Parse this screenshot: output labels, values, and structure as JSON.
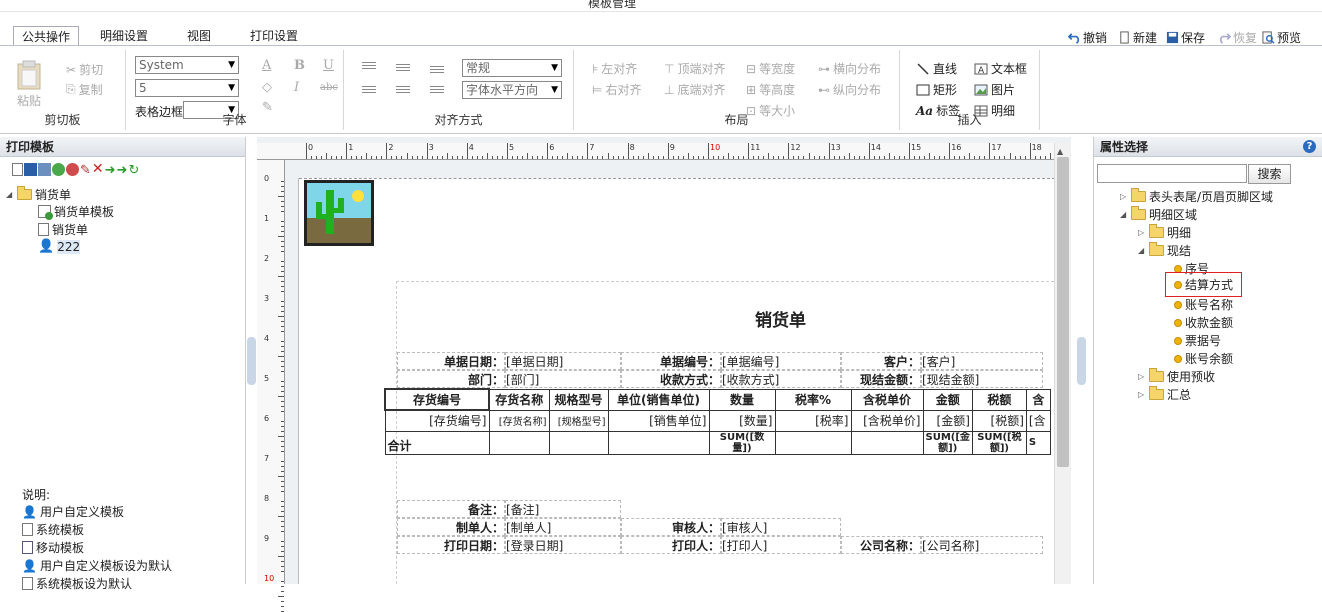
{
  "window": {
    "title": "模板管理"
  },
  "tabs": [
    {
      "label": "公共操作"
    },
    {
      "label": "明细设置"
    },
    {
      "label": "视图"
    },
    {
      "label": "打印设置"
    }
  ],
  "quick_actions": {
    "undo": "撤销",
    "new": "新建",
    "save": "保存",
    "redo": "恢复",
    "preview": "预览"
  },
  "ribbon": {
    "clipboard": {
      "label": "剪切板",
      "paste": "粘贴",
      "cut": "剪切",
      "copy": "复制"
    },
    "font": {
      "label": "字体",
      "family": "System",
      "size": "5",
      "table_border_label": "表格边框",
      "table_border_value": ""
    },
    "align": {
      "label": "对齐方式",
      "style": "常规",
      "horizontal": "字体水平方向"
    },
    "layout": {
      "label": "布局",
      "left": "左对齐",
      "top": "顶端对齐",
      "same_width": "等宽度",
      "h_dist": "横向分布",
      "right": "右对齐",
      "bottom": "底端对齐",
      "same_height": "等高度",
      "v_dist": "纵向分布",
      "same_size": "等大小"
    },
    "insert": {
      "label": "插入",
      "line": "直线",
      "textbox": "文本框",
      "rect": "矩形",
      "image": "图片",
      "label_btn": "标签",
      "detail": "明细"
    }
  },
  "left": {
    "title": "打印模板",
    "tree": {
      "root": "销货单",
      "items": [
        "销货单模板",
        "销货单",
        "222"
      ]
    },
    "legend": {
      "title": "说明:",
      "items": [
        "用户自定义模板",
        "系统模板",
        "移动模板",
        "用户自定义模板设为默认",
        "系统模板设为默认"
      ]
    }
  },
  "right": {
    "title": "属性选择",
    "search_button": "搜索",
    "search_value": "",
    "tree": {
      "header_footer": "表头表尾/页眉页脚区域",
      "detail_area": "明细区域",
      "detail": "明细",
      "cash": "现结",
      "fields": [
        "序号",
        "结算方式",
        "账号名称",
        "收款金额",
        "票据号",
        "账号余额"
      ],
      "prepay": "使用预收",
      "summary": "汇总"
    }
  },
  "ruler": {
    "top": [
      "0",
      "1",
      "2",
      "3",
      "4",
      "5",
      "6",
      "7",
      "8",
      "9",
      "10",
      "11",
      "12",
      "13",
      "14",
      "15",
      "16",
      "17",
      "18"
    ],
    "left": [
      "0",
      "1",
      "2",
      "3",
      "4",
      "5",
      "6",
      "7",
      "8",
      "9",
      "10"
    ]
  },
  "sheet": {
    "title": "销货单",
    "header": [
      {
        "label": "单据日期：",
        "value": "[单据日期]"
      },
      {
        "label": "单据编号：",
        "value": "[单据编号]"
      },
      {
        "label": "客户：",
        "value": "[客户]"
      },
      {
        "label": "部门：",
        "value": "[部门]"
      },
      {
        "label": "收款方式：",
        "value": "[收款方式]"
      },
      {
        "label": "现结金额：",
        "value": "[现结金额]"
      }
    ],
    "columns": [
      "存货编号",
      "存货名称",
      "规格型号",
      "单位(销售单位)",
      "数量",
      "税率%",
      "含税单价",
      "金额",
      "税额",
      "含"
    ],
    "row": [
      "[存货编号]",
      "[存货名称]",
      "[规格型号]",
      "[销售单位]",
      "[数量]",
      "[税率]",
      "[含税单价]",
      "[金额]",
      "[税额]",
      "[含"
    ],
    "total_label": "合计",
    "totals": [
      "SUM([数量])",
      "SUM([金额])",
      "SUM([税额])",
      "S"
    ],
    "footer": [
      {
        "label": "备注：",
        "value": "[备注]"
      },
      {
        "label": "制单人：",
        "value": "[制单人]"
      },
      {
        "label": "审核人：",
        "value": "[审核人]"
      },
      {
        "label": "打印日期：",
        "value": "[登录日期]"
      },
      {
        "label": "打印人：",
        "value": "[打印人]"
      },
      {
        "label": "公司名称：",
        "value": "[公司名称]"
      }
    ]
  }
}
